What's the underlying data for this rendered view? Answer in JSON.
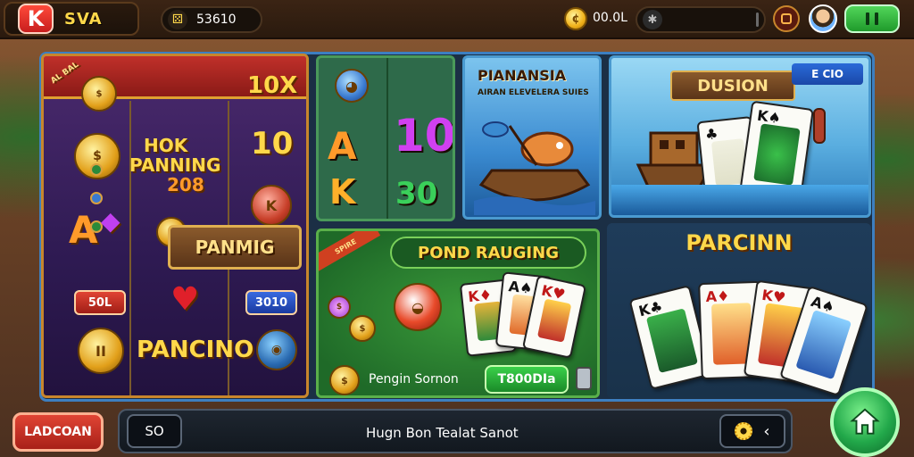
{
  "header": {
    "logo_letter": "K",
    "logo_text": "SVA",
    "score": "53610",
    "coins": "00.0L",
    "score_icon": "dice-icon",
    "coin_icon": "coin-icon",
    "search_icon": "search-icon"
  },
  "panels": {
    "slot": {
      "corner_tag": "AL BAL",
      "multiplier": "10X",
      "center_title_1": "HOK",
      "center_title_2": "PANNING",
      "center_num": "208",
      "side_10": "10",
      "banner": "PANMIG",
      "btn_red": "50L",
      "btn_blue": "3010",
      "bottom_title": "PANCINO"
    },
    "reels": {
      "r1": "A",
      "r2": "10",
      "r3": "K",
      "r4": "30"
    },
    "fish": {
      "title": "PIANANSIA",
      "subtitle": "AIRAN ELEVELERA SUIES"
    },
    "boat": {
      "title": "DUSION",
      "tag": "E CIO"
    },
    "pond": {
      "title": "POND RAUGING",
      "ribbon": "SPIRE",
      "footer_label": "Pengin Sornon",
      "footer_button": "T800DIa"
    },
    "cards": {
      "title": "PARCINN"
    }
  },
  "bottom": {
    "left_button": "LADCOAN",
    "so_button": "SO",
    "chat_text": "Hugn Bon Tealat Sanot",
    "home_icon": "home-icon"
  }
}
